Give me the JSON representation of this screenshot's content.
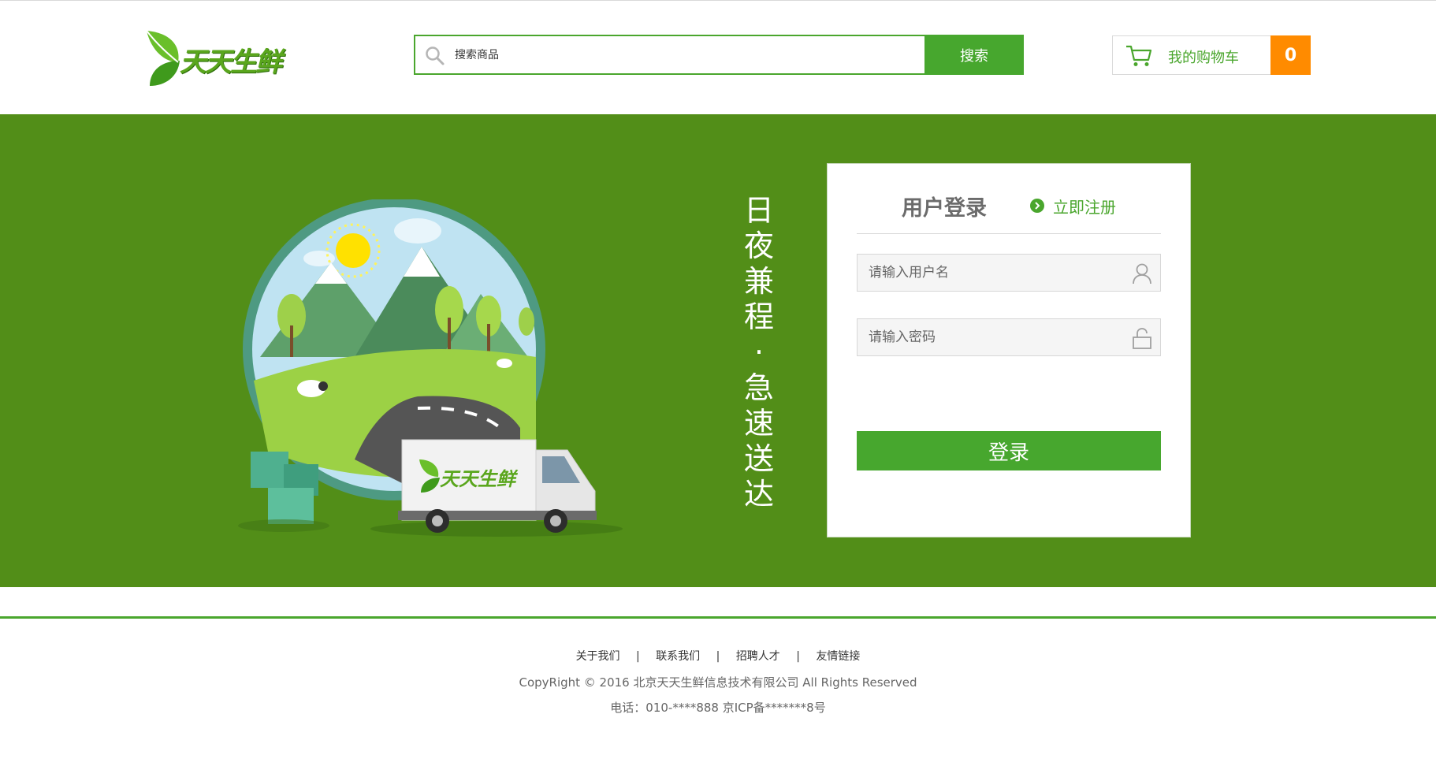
{
  "header": {
    "logo_text": "天天生鲜",
    "search": {
      "placeholder": "搜索商品",
      "button_label": "搜索"
    },
    "cart": {
      "label": "我的购物车",
      "count": "0"
    }
  },
  "banner": {
    "slogan": [
      "日",
      "夜",
      "兼",
      "程",
      "·",
      "急",
      "速",
      "送",
      "达"
    ],
    "truck_logo_text": "天天生鲜"
  },
  "login": {
    "title": "用户登录",
    "register_label": "立即注册",
    "username_placeholder": "请输入用户名",
    "password_placeholder": "请输入密码",
    "submit_label": "登录"
  },
  "footer": {
    "links": [
      "关于我们",
      "联系我们",
      "招聘人才",
      "友情链接"
    ],
    "separator": "|",
    "copyright": "CopyRight © 2016 北京天天生鲜信息技术有限公司 All Rights Reserved",
    "contact": "电话：010-****888    京ICP备*******8号"
  },
  "colors": {
    "brand_green": "#47a72e",
    "banner_green": "#528e18",
    "cart_orange": "#ff8b00"
  }
}
